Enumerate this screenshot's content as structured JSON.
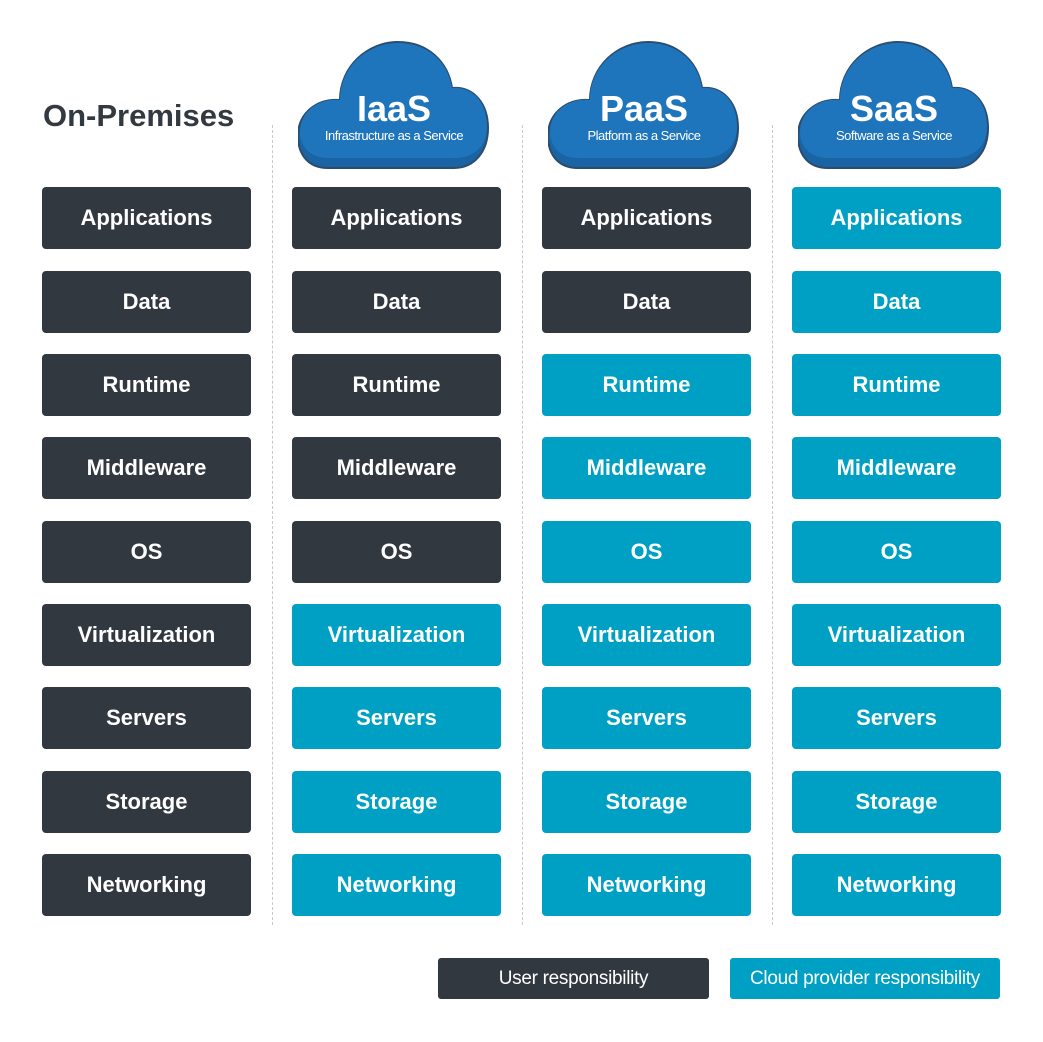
{
  "title": "On-Premises",
  "colors": {
    "user": "#323840",
    "provider": "#00a0c4",
    "cloud": "#1e75bc",
    "cloud_shadow": "#1a64a4"
  },
  "layers": [
    "Applications",
    "Data",
    "Runtime",
    "Middleware",
    "OS",
    "Virtualization",
    "Servers",
    "Storage",
    "Networking"
  ],
  "models": [
    {
      "name": "On-Premises",
      "cloud": false,
      "provider_managed": [
        false,
        false,
        false,
        false,
        false,
        false,
        false,
        false,
        false
      ]
    },
    {
      "name": "IaaS",
      "subtitle": "Infrastructure as a Service",
      "cloud": true,
      "provider_managed": [
        false,
        false,
        false,
        false,
        false,
        true,
        true,
        true,
        true
      ]
    },
    {
      "name": "PaaS",
      "subtitle": "Platform as a Service",
      "cloud": true,
      "provider_managed": [
        false,
        false,
        true,
        true,
        true,
        true,
        true,
        true,
        true
      ]
    },
    {
      "name": "SaaS",
      "subtitle": "Software as a Service",
      "cloud": true,
      "provider_managed": [
        true,
        true,
        true,
        true,
        true,
        true,
        true,
        true,
        true
      ]
    }
  ],
  "legend": {
    "user": "User responsibility",
    "provider": "Cloud provider responsibility"
  }
}
